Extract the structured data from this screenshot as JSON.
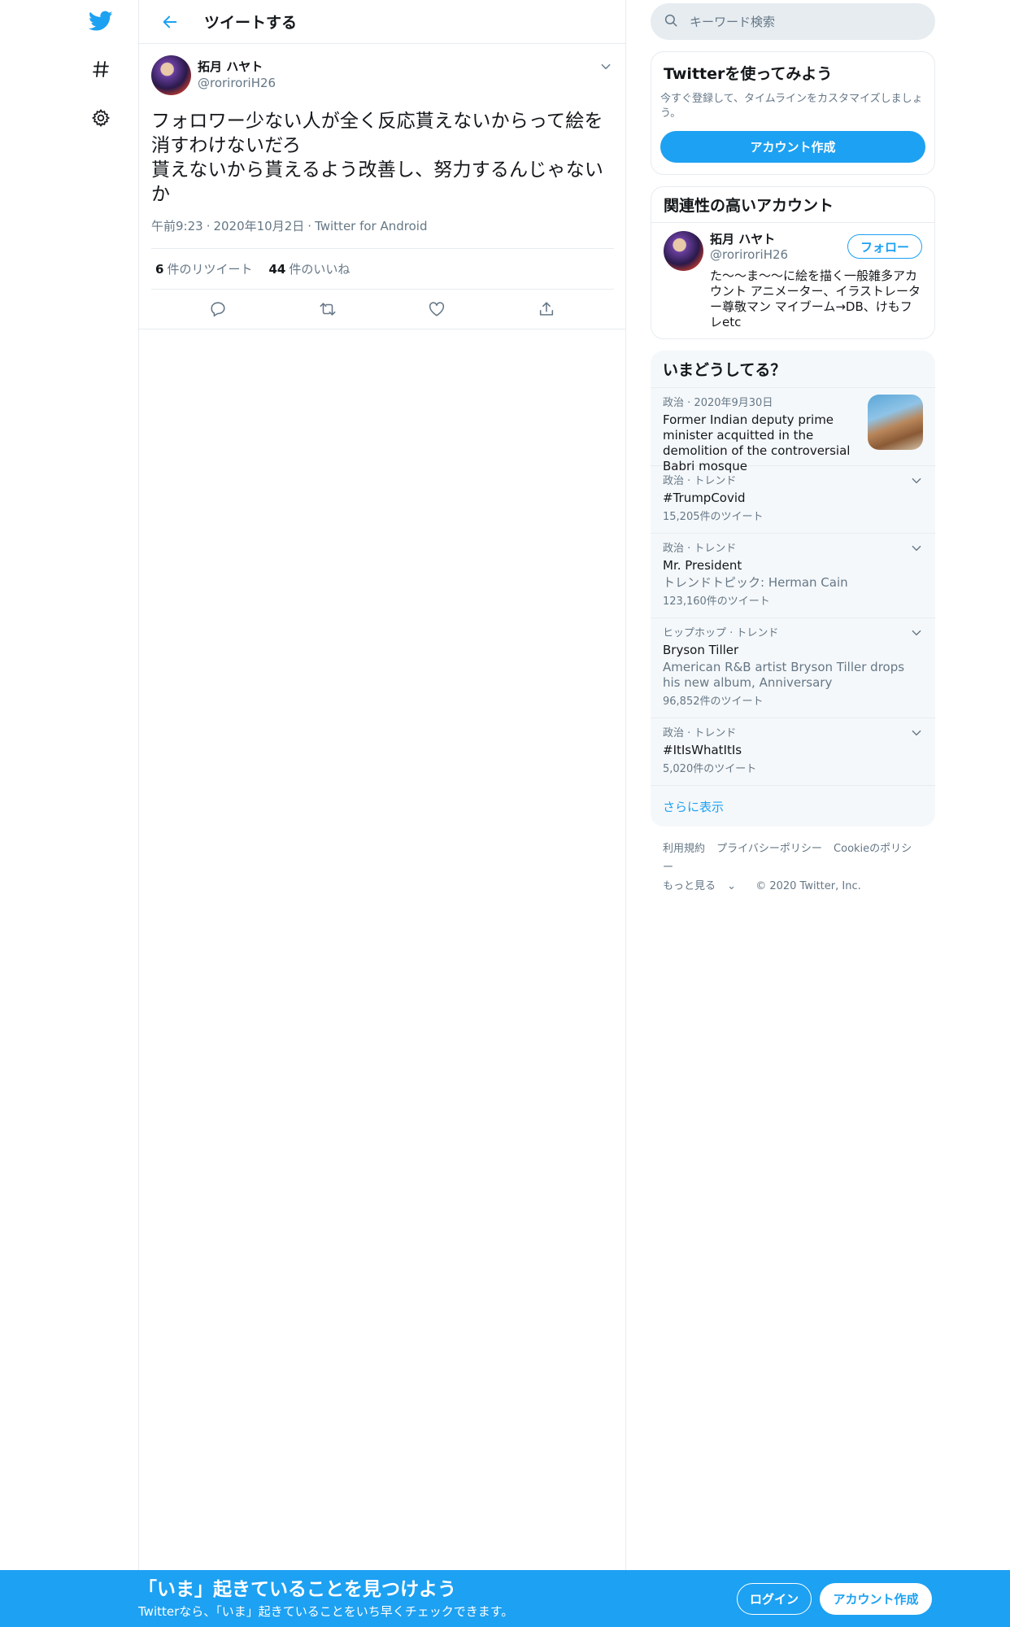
{
  "nav": {
    "icons": [
      "twitter-logo-icon",
      "hashtag-icon",
      "settings-gear-icon"
    ]
  },
  "header": {
    "title": "ツイートする"
  },
  "tweet": {
    "author_name": "拓月 ハヤト",
    "author_handle": "@roriroriH26",
    "text": "フォロワー少ない人が全く反応貰えないからって絵を消すわけないだろ\n貰えないから貰えるよう改善し、努力するんじゃないか",
    "time": "午前9:23",
    "date": "2020年10月2日",
    "source": "Twitter for Android",
    "retweet_count": "6",
    "retweet_label": "件のリツイート",
    "like_count": "44",
    "like_label": "件のいいね"
  },
  "search": {
    "placeholder": "キーワード検索"
  },
  "signup_card": {
    "title": "Twitterを使ってみよう",
    "description": "今すぐ登録して、タイムラインをカスタマイズしましょう。",
    "button": "アカウント作成"
  },
  "related": {
    "title": "関連性の高いアカウント",
    "name": "拓月 ハヤト",
    "handle": "@roriroriH26",
    "bio": "た～～ま～～に絵を描く一般雑多アカウント アニメーター、イラストレーター尊敬マン マイブーム→DB、けもフレetc",
    "follow": "フォロー"
  },
  "trends": {
    "title": "いまどうしてる？",
    "news": {
      "category": "政治",
      "date": "2020年9月30日",
      "headline": "Former Indian deputy prime minister acquitted in the demolition of the controversial Babri mosque"
    },
    "items": [
      {
        "category": "政治 · トレンド",
        "name": "#TrumpCovid",
        "sub": "",
        "count": "15,205件のツイート"
      },
      {
        "category": "政治 · トレンド",
        "name": "Mr. President",
        "sub": "トレンドトピック: Herman Cain",
        "count": "123,160件のツイート"
      },
      {
        "category": "ヒップホップ · トレンド",
        "name": "Bryson Tiller",
        "sub": "American R&B artist Bryson Tiller drops his new album, Anniversary",
        "count": "96,852件のツイート"
      },
      {
        "category": "政治 · トレンド",
        "name": "#ItIsWhatItIs",
        "sub": "",
        "count": "5,020件のツイート"
      }
    ],
    "show_more": "さらに表示"
  },
  "footer": {
    "terms": "利用規約",
    "privacy": "プライバシーポリシー",
    "cookies": "Cookieのポリシー",
    "more": "もっと見る",
    "copyright": "© 2020 Twitter, Inc."
  },
  "bottom_bar": {
    "title": "「いま」起きていることを見つけよう",
    "subtitle": "Twitterなら、「いま」起きていることをいち早くチェックできます。",
    "login": "ログイン",
    "signup": "アカウント作成"
  },
  "colors": {
    "accent": "#1da1f2",
    "border": "#e6ecf0",
    "secondary_text": "#657786"
  }
}
